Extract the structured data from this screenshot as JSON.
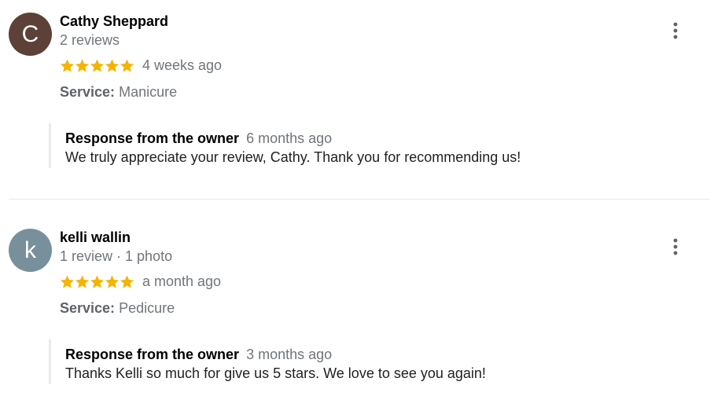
{
  "colors": {
    "star": "#f4b400",
    "avatar_1": "#5d4037",
    "avatar_2": "#78909c",
    "secondary_text": "#70757a",
    "response_border": "#e8eaed"
  },
  "reviews": [
    {
      "avatar_letter": "C",
      "name": "Cathy Sheppard",
      "meta": "2 reviews",
      "rating": 5,
      "time": "4 weeks ago",
      "service_label": "Service:",
      "service_value": "Manicure",
      "response_title": "Response from the owner",
      "response_time": "6 months ago",
      "response_text": "We truly appreciate your review, Cathy. Thank you for recommending us!",
      "more_icon": "more-vert-icon"
    },
    {
      "avatar_letter": "k",
      "name": "kelli wallin",
      "meta": "1 review · 1 photo",
      "rating": 5,
      "time": "a month ago",
      "service_label": "Service:",
      "service_value": "Pedicure",
      "response_title": "Response from the owner",
      "response_time": "3 months ago",
      "response_text": "Thanks Kelli so much for give us 5 stars. We love to see you again!",
      "more_icon": "more-vert-icon"
    }
  ]
}
